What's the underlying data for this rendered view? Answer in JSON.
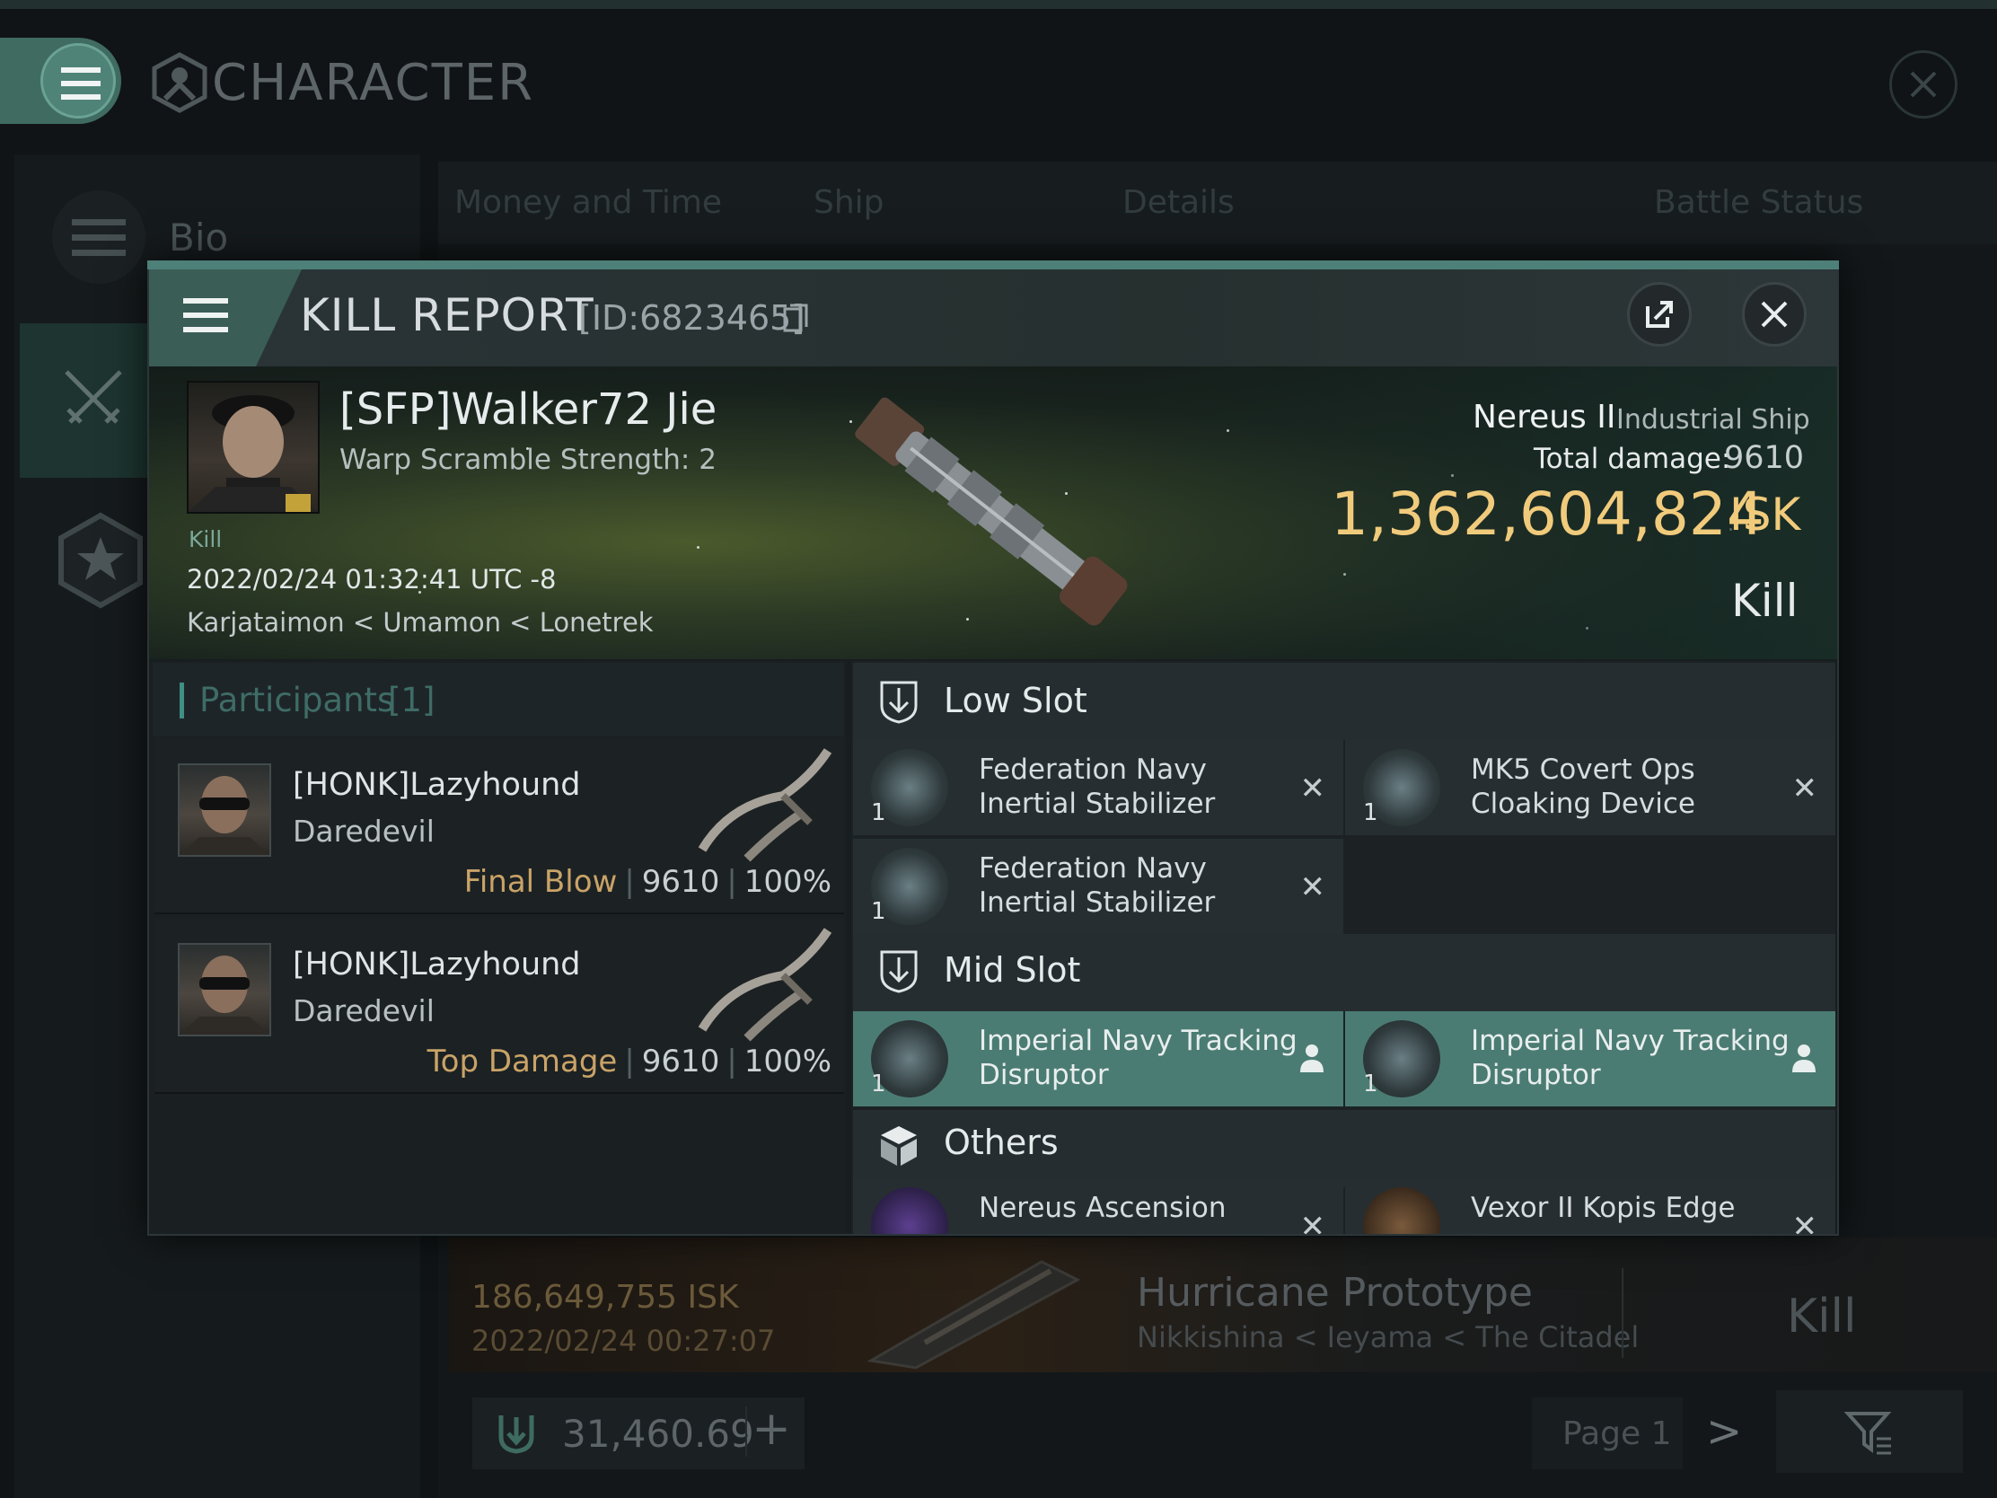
{
  "app": {
    "title": "CHARACTER",
    "sidebar": {
      "bio_label": "Bio"
    },
    "tabs": [
      "Money and Time",
      "Ship",
      "Details",
      "Battle Status"
    ],
    "background_entry": {
      "isk": "186,649,755  ISK",
      "date": "2022/02/24  00:27:07",
      "ship": "Hurricane Prototype",
      "location": "Nikkishina < Ieyama < The Citadel",
      "result": "Kill"
    },
    "wallet": {
      "value": "31,460.69",
      "add_label": "+"
    },
    "pagination": {
      "page_label": "Page 1",
      "next_label": ">"
    }
  },
  "kill_report": {
    "title": "KILL REPORT",
    "id_label": "[ID:6823465]",
    "victim": {
      "name": "[SFP]Walker72 Jie",
      "warp_scramble": "Warp Scramble Strength: 2",
      "tag": "Kill",
      "datetime": "2022/02/24 01:32:41 UTC -8",
      "location": "Karjataimon < Umamon < Lonetrek"
    },
    "ship": {
      "name": "Nereus II",
      "type": "Industrial Ship",
      "total_damage_label": "Total damage:",
      "total_damage": "9610",
      "isk_value": "1,362,604,824",
      "isk_unit": "ISK",
      "result": "Kill"
    },
    "participants": {
      "label": "Participants",
      "count": "[1]",
      "rows": [
        {
          "name": "[HONK]Lazyhound",
          "ship": "Daredevil",
          "role": "Final Blow",
          "damage": "9610",
          "percent": "100%"
        },
        {
          "name": "[HONK]Lazyhound",
          "ship": "Daredevil",
          "role": "Top Damage",
          "damage": "9610",
          "percent": "100%"
        }
      ]
    },
    "fitting": {
      "low_slot": {
        "label": "Low Slot",
        "items": [
          {
            "name": "Federation Navy Inertial Stabilizer",
            "qty": "1",
            "status": "destroyed"
          },
          {
            "name": "MK5 Covert Ops Cloaking Device",
            "qty": "1",
            "status": "destroyed"
          },
          {
            "name": "Federation Navy Inertial Stabilizer",
            "qty": "1",
            "status": "destroyed"
          }
        ]
      },
      "mid_slot": {
        "label": "Mid Slot",
        "items": [
          {
            "name": "Imperial Navy Tracking Disruptor",
            "qty": "1",
            "status": "dropped"
          },
          {
            "name": "Imperial Navy Tracking Disruptor",
            "qty": "1",
            "status": "dropped"
          }
        ]
      },
      "others": {
        "label": "Others",
        "items": [
          {
            "name": "Nereus Ascension",
            "status": "destroyed"
          },
          {
            "name": "Vexor II Kopis Edge",
            "status": "destroyed"
          }
        ]
      }
    }
  },
  "colors": {
    "accent_teal": "#4b7c73",
    "isk_gold": "#f1cb7c",
    "role_gold": "#caa367",
    "participants_teal": "#3e6c66"
  },
  "icons": [
    "menu-icon",
    "character-logo-icon",
    "close-icon",
    "bio-menu-icon",
    "crossed-swords-icon",
    "star-badge-icon",
    "external-link-icon",
    "copy-icon",
    "low-slot-icon",
    "mid-slot-icon",
    "others-cube-icon",
    "person-icon",
    "filter-icon",
    "wallet-icon",
    "plus-icon"
  ]
}
